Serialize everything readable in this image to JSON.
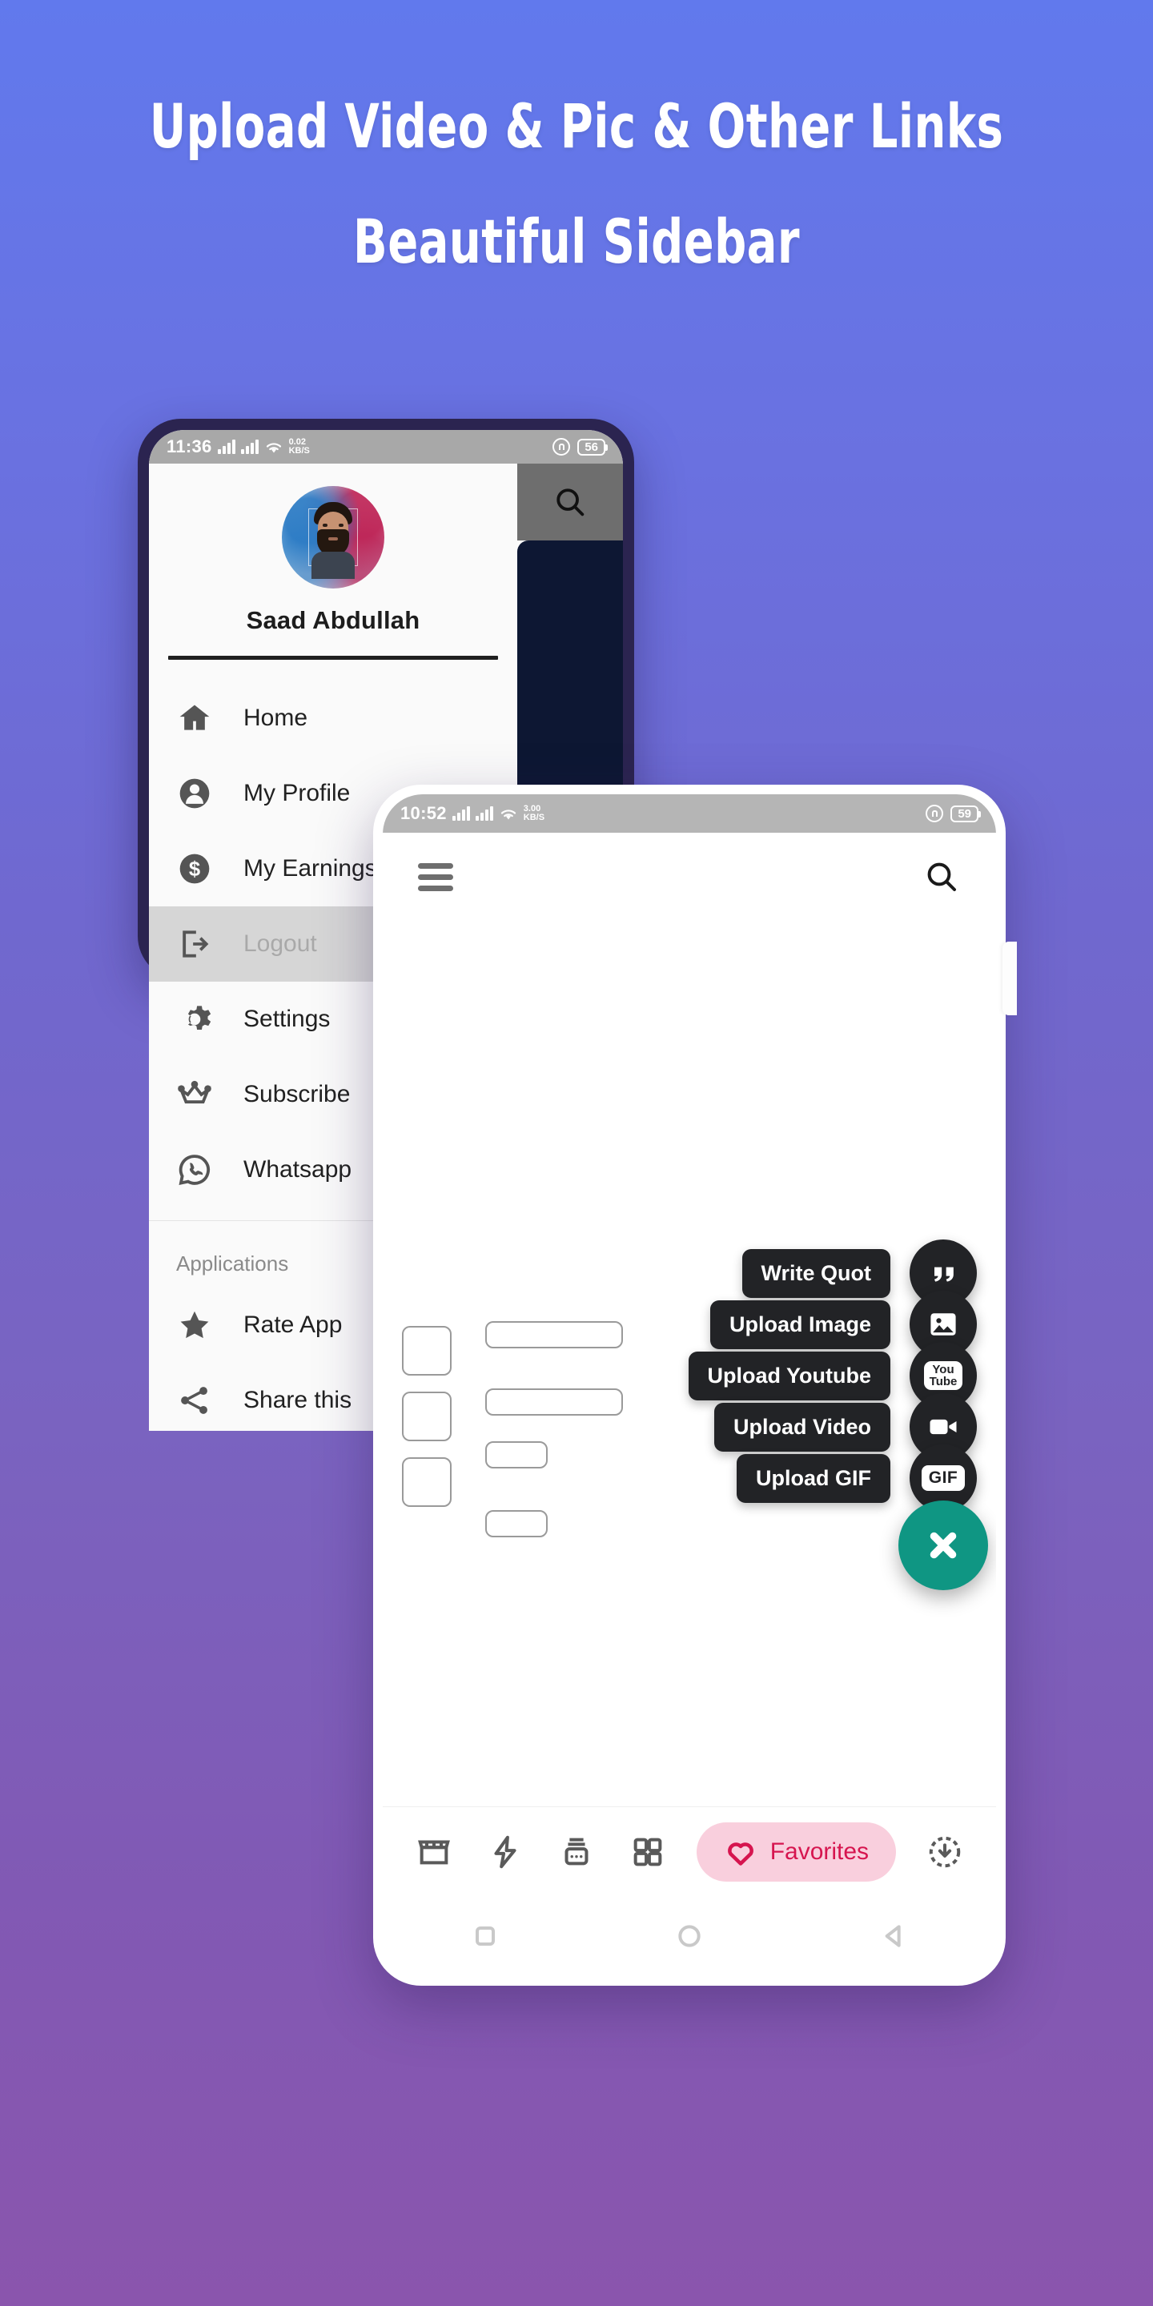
{
  "headline": {
    "line1": "Upload Video & Pic & Other Links",
    "line2": "Beautiful Sidebar"
  },
  "colors": {
    "bg_top": "#6179ed",
    "bg_bottom": "#8a55ad",
    "phone_frame": "#2b2450",
    "fab_dark": "#222326",
    "fab_close": "#0f9683",
    "favorites_pink_bg": "#f9cfdd",
    "favorites_pink_fg": "#d6154f",
    "dark_panel": "#0d1733",
    "active_item_bg": "#d6d6d6"
  },
  "phone1": {
    "statusbar": {
      "time": "11:36",
      "netspeed_value": "0.02",
      "netspeed_unit": "KB/S",
      "battery": "56",
      "signal_icon": "signal-bars-icon",
      "wifi_icon": "wifi-icon",
      "lock_icon": "lock-icon"
    },
    "search_icon": "search-icon",
    "profile": {
      "name": "Saad Abdullah",
      "avatar_alt": "user-avatar"
    },
    "menu": [
      {
        "label": "Home",
        "icon": "home-icon",
        "active": false
      },
      {
        "label": "My Profile",
        "icon": "person-circle-icon",
        "active": false
      },
      {
        "label": "My Earnings",
        "icon": "dollar-circle-icon",
        "active": false
      },
      {
        "label": "Logout",
        "icon": "logout-icon",
        "active": true
      },
      {
        "label": "Settings",
        "icon": "gear-icon",
        "active": false
      },
      {
        "label": "Subscribe",
        "icon": "crown-icon",
        "active": false
      },
      {
        "label": "Whatsapp",
        "icon": "whatsapp-icon",
        "active": false
      }
    ],
    "section_title": "Applications",
    "applications": [
      {
        "label": "Rate App",
        "icon": "star-icon"
      },
      {
        "label": "Share this",
        "icon": "share-icon"
      }
    ]
  },
  "phone2": {
    "statusbar": {
      "time": "10:52",
      "netspeed_value": "3.00",
      "netspeed_unit": "KB/S",
      "battery": "59",
      "signal_icon": "signal-bars-icon",
      "wifi_icon": "wifi-icon",
      "lock_icon": "lock-icon"
    },
    "appbar": {
      "menu_icon": "hamburger-menu-icon",
      "search_icon": "search-icon"
    },
    "fab_actions": [
      {
        "label": "Write Quot",
        "icon": "quote-icon"
      },
      {
        "label": "Upload Image",
        "icon": "image-icon"
      },
      {
        "label": "Upload Youtube",
        "icon": "youtube-icon"
      },
      {
        "label": "Upload Video",
        "icon": "video-camera-icon"
      },
      {
        "label": "Upload GIF",
        "icon": "gif-icon"
      }
    ],
    "fab_close": {
      "icon": "close-icon"
    },
    "bottom_nav": [
      {
        "name": "store",
        "icon": "store-icon",
        "label": "",
        "active": false
      },
      {
        "name": "flash",
        "icon": "lightning-bolt-icon",
        "label": "",
        "active": false
      },
      {
        "name": "archive",
        "icon": "archive-box-icon",
        "label": "",
        "active": false
      },
      {
        "name": "grid",
        "icon": "grid-icon",
        "label": "",
        "active": false
      },
      {
        "name": "favorites",
        "icon": "heart-icon",
        "label": "Favorites",
        "active": true
      },
      {
        "name": "downloads",
        "icon": "download-circle-icon",
        "label": "",
        "active": false
      }
    ],
    "system_nav": [
      "square-icon",
      "circle-icon",
      "back-triangle-icon"
    ]
  }
}
